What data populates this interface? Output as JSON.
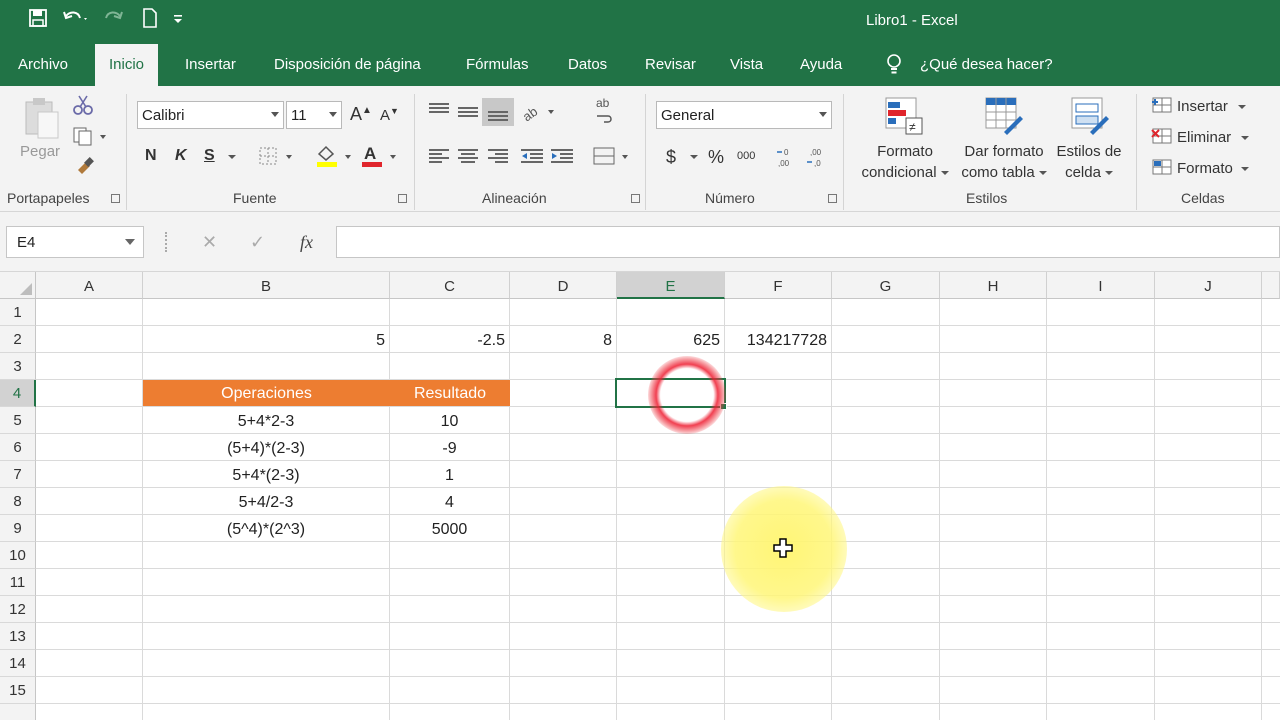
{
  "window": {
    "title": "Libro1  -  Excel"
  },
  "tabs": [
    "Archivo",
    "Inicio",
    "Insertar",
    "Disposición de página",
    "Fórmulas",
    "Datos",
    "Revisar",
    "Vista",
    "Ayuda"
  ],
  "active_tab": "Inicio",
  "tell_me": "¿Qué desea hacer?",
  "ribbon": {
    "clipboard": {
      "paste": "Pegar",
      "group": "Portapapeles"
    },
    "font": {
      "name": "Calibri",
      "size": "11",
      "bold": "N",
      "italic": "K",
      "underline": "S",
      "group": "Fuente"
    },
    "alignment": {
      "group": "Alineación"
    },
    "number": {
      "format": "General",
      "currency": "$",
      "percent": "%",
      "thousands": "000",
      "group": "Número"
    },
    "styles": {
      "conditional_1": "Formato",
      "conditional_2": "condicional",
      "as_table_1": "Dar formato",
      "as_table_2": "como tabla",
      "cell_styles_1": "Estilos de",
      "cell_styles_2": "celda",
      "group": "Estilos"
    },
    "cells": {
      "insert": "Insertar",
      "delete": "Eliminar",
      "format": "Formato",
      "group": "Celdas"
    }
  },
  "formula_bar": {
    "name_box": "E4",
    "fx": "fx",
    "formula": ""
  },
  "sheet": {
    "columns": [
      "A",
      "B",
      "C",
      "D",
      "E",
      "F",
      "G",
      "H",
      "I",
      "J"
    ],
    "rows": [
      "1",
      "2",
      "3",
      "4",
      "5",
      "6",
      "7",
      "8",
      "9",
      "10",
      "11",
      "12",
      "13",
      "14",
      "15"
    ],
    "selected_cell": "E4",
    "row2": {
      "B": "5",
      "C": "-2.5",
      "D": "8",
      "E": "625",
      "F": "134217728"
    },
    "table": {
      "header": [
        "Operaciones",
        "Resultado"
      ],
      "rows": [
        [
          "5+4*2-3",
          "10"
        ],
        [
          "(5+4)*(2-3)",
          "-9"
        ],
        [
          "5+4*(2-3)",
          "1"
        ],
        [
          "5+4/2-3",
          "4"
        ],
        [
          "(5^4)*(2^3)",
          "5000"
        ]
      ]
    }
  },
  "colors": {
    "excel_green": "#217346",
    "table_header": "#ed7d31"
  }
}
